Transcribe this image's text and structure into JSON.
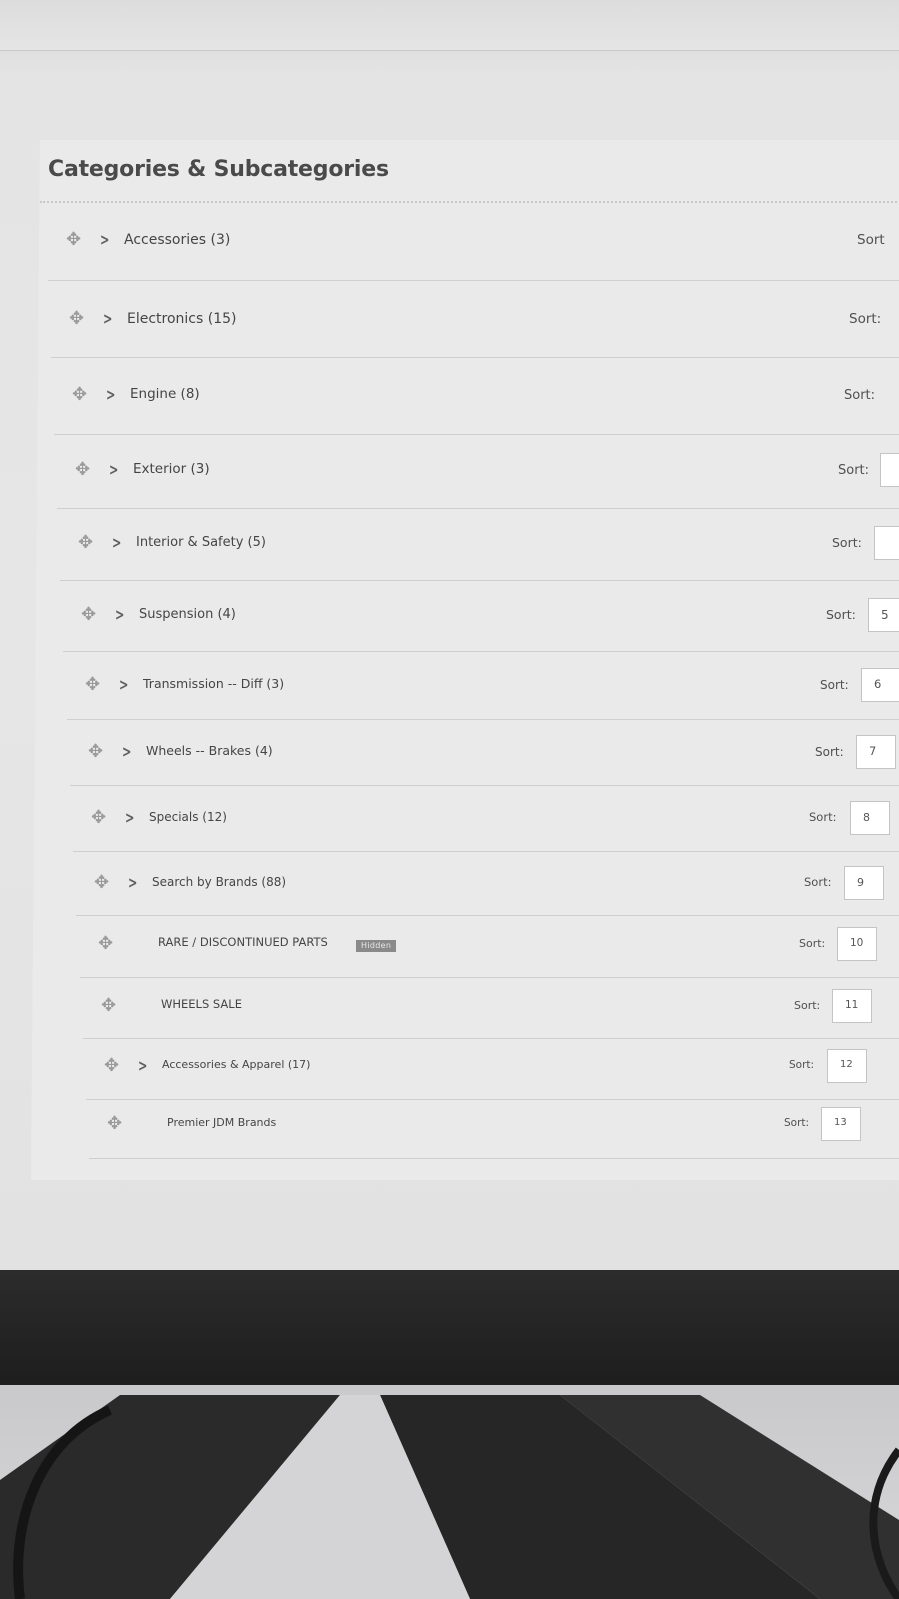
{
  "panel": {
    "title": "Categories & Subcategories"
  },
  "categories": [
    {
      "label": "Accessories (3)",
      "has_children": true,
      "sort_label": "Sort",
      "sort_value": ""
    },
    {
      "label": "Electronics (15)",
      "has_children": true,
      "sort_label": "Sort:",
      "sort_value": ""
    },
    {
      "label": "Engine (8)",
      "has_children": true,
      "sort_label": "Sort:",
      "sort_value": ""
    },
    {
      "label": "Exterior (3)",
      "has_children": true,
      "sort_label": "Sort:",
      "sort_value": ""
    },
    {
      "label": "Interior & Safety (5)",
      "has_children": true,
      "sort_label": "Sort:",
      "sort_value": ""
    },
    {
      "label": "Suspension (4)",
      "has_children": true,
      "sort_label": "Sort:",
      "sort_value": "5"
    },
    {
      "label": "Transmission -- Diff (3)",
      "has_children": true,
      "sort_label": "Sort:",
      "sort_value": "6"
    },
    {
      "label": "Wheels -- Brakes (4)",
      "has_children": true,
      "sort_label": "Sort:",
      "sort_value": "7"
    },
    {
      "label": "Specials (12)",
      "has_children": true,
      "sort_label": "Sort:",
      "sort_value": "8"
    },
    {
      "label": "Search by Brands (88)",
      "has_children": true,
      "sort_label": "Sort:",
      "sort_value": "9"
    },
    {
      "label": "RARE / DISCONTINUED PARTS",
      "has_children": false,
      "badge": "Hidden",
      "sort_label": "Sort:",
      "sort_value": "10"
    },
    {
      "label": "WHEELS SALE",
      "has_children": false,
      "sort_label": "Sort:",
      "sort_value": "11"
    },
    {
      "label": "Accessories & Apparel (17)",
      "has_children": true,
      "sort_label": "Sort:",
      "sort_value": "12"
    },
    {
      "label": "Premier JDM Brands",
      "has_children": false,
      "sort_label": "Sort:",
      "sort_value": "13"
    }
  ],
  "icons": {
    "drag": "drag-handle-icon",
    "expand": "chevron-right-icon"
  }
}
